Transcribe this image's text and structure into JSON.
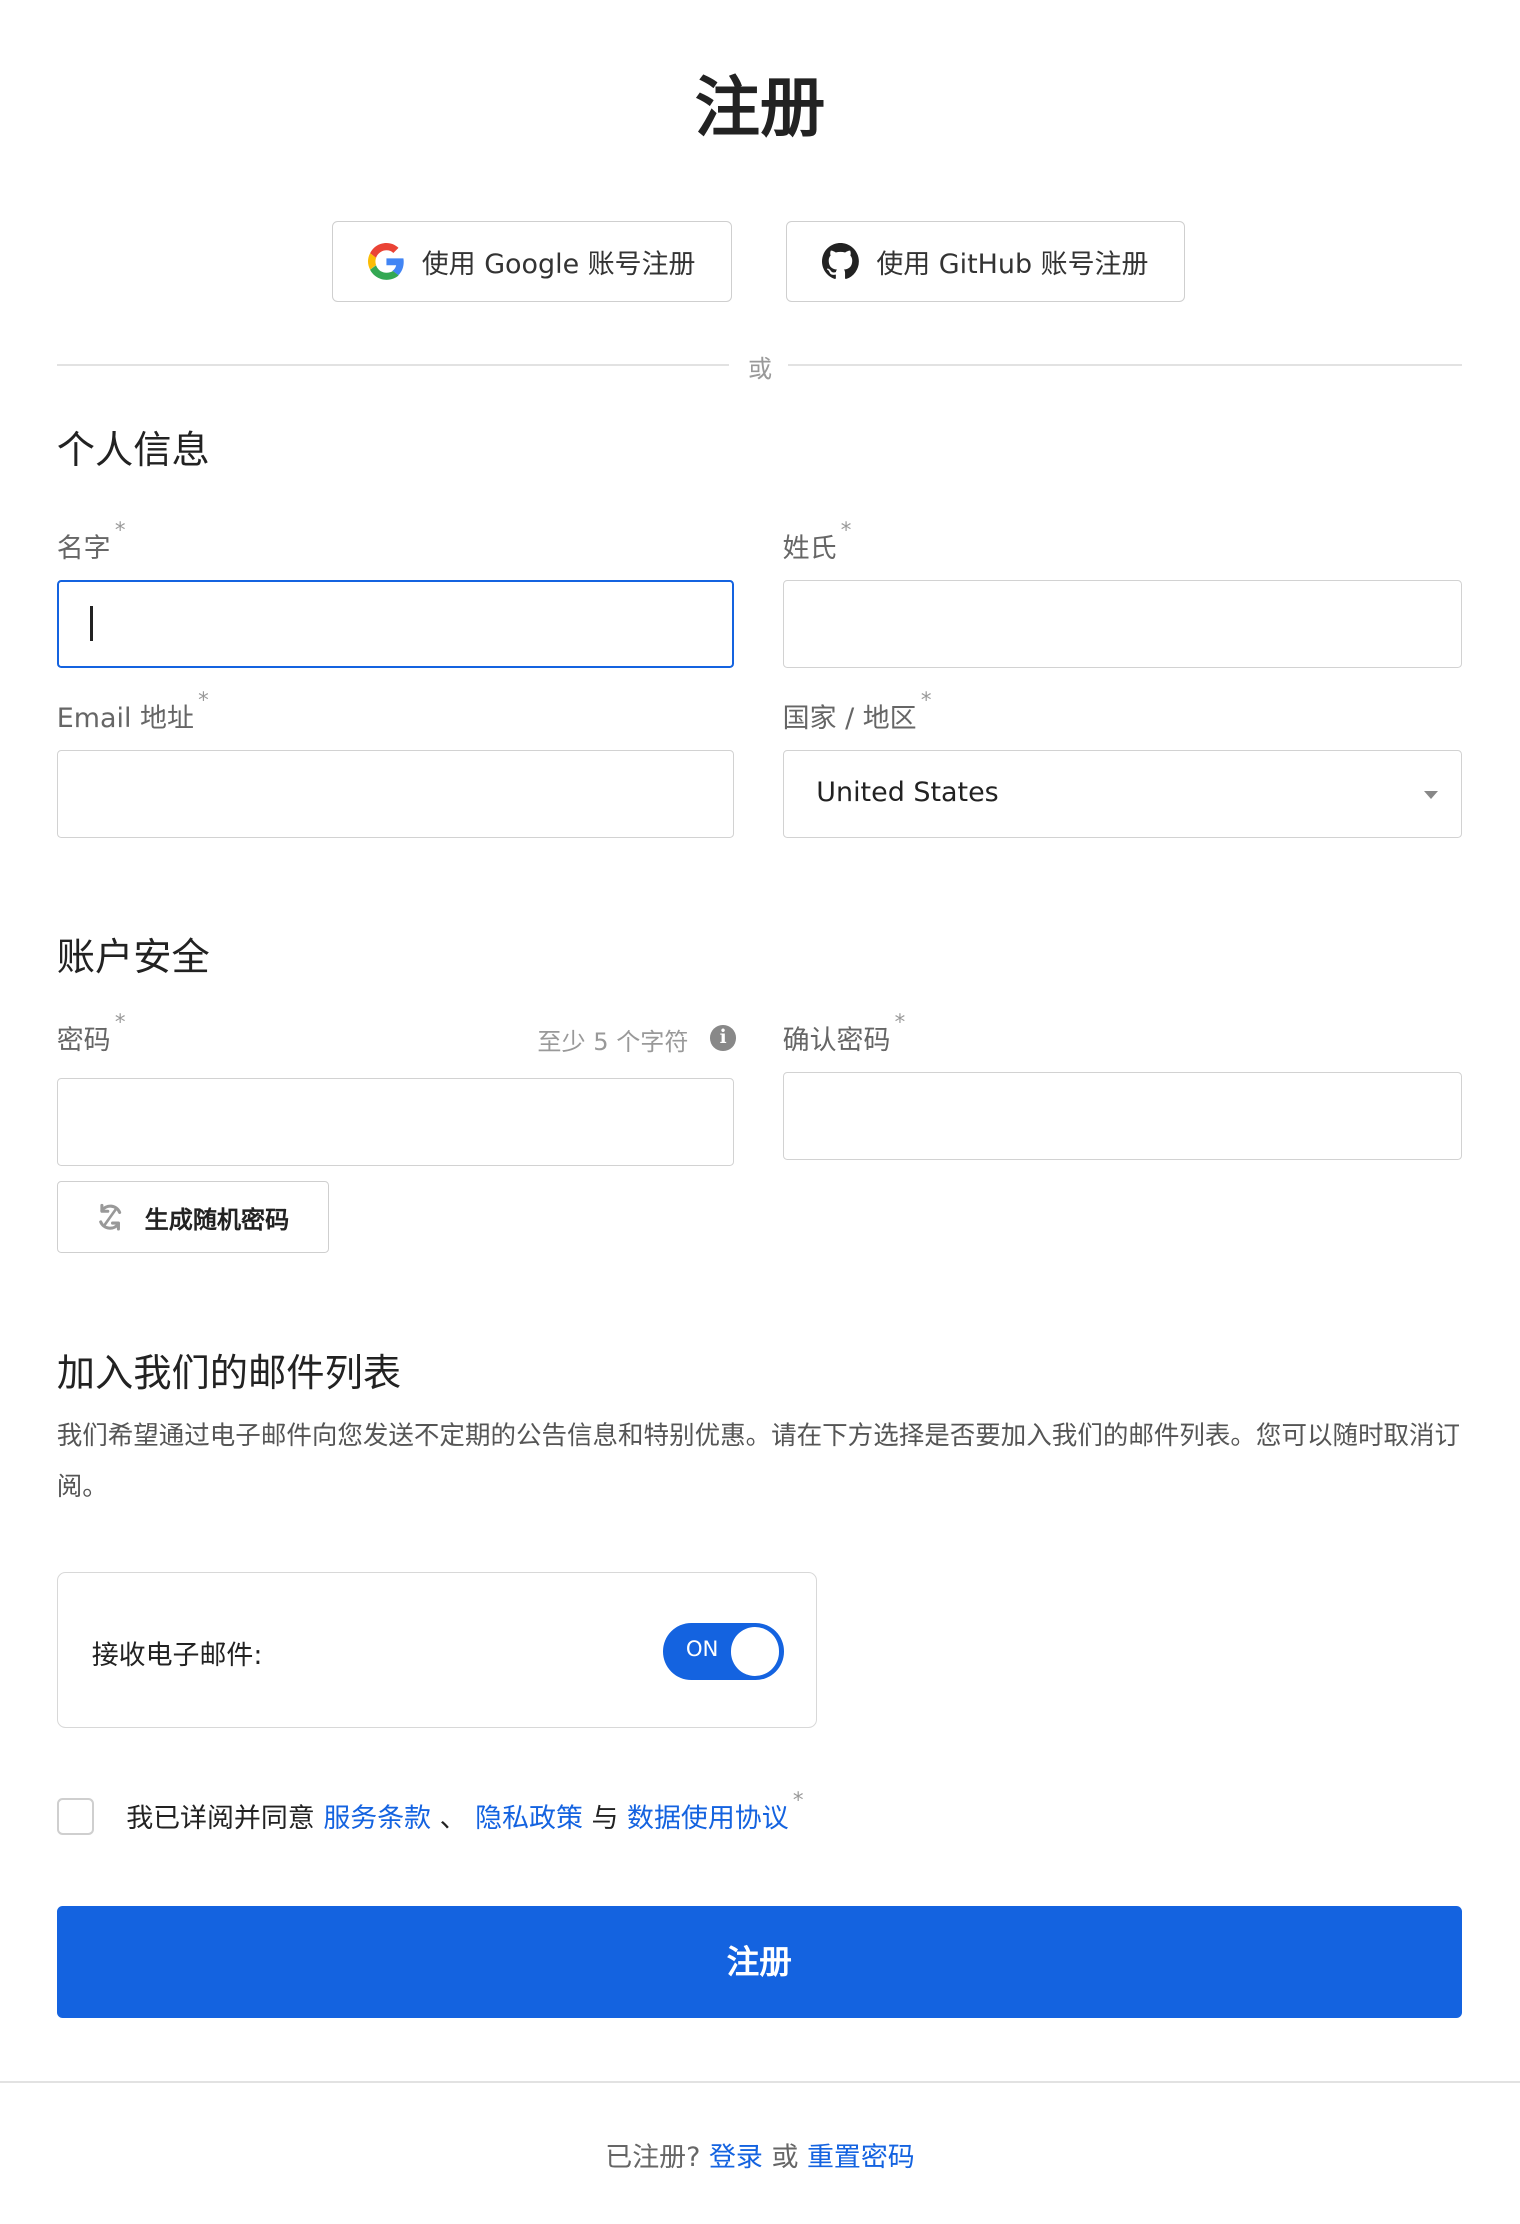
{
  "page": {
    "title": "注册"
  },
  "oauth": {
    "google_label": "使用 Google 账号注册",
    "github_label": "使用 GitHub 账号注册"
  },
  "divider": {
    "text": "或"
  },
  "personal": {
    "title": "个人信息",
    "first_name_label": "名字",
    "last_name_label": "姓氏",
    "email_label": "Email 地址",
    "country_label": "国家 / 地区",
    "country_value": "United States",
    "required_mark": "*"
  },
  "security": {
    "title": "账户安全",
    "password_label": "密码",
    "password_hint": "至少 5 个字符",
    "confirm_label": "确认密码",
    "generate_label": "生成随机密码"
  },
  "mailing": {
    "title": "加入我们的邮件列表",
    "description": "我们希望通过电子邮件向您发送不定期的公告信息和特别优惠。请在下方选择是否要加入我们的邮件列表。您可以随时取消订阅。",
    "receive_label": "接收电子邮件:",
    "toggle_state": "ON"
  },
  "terms": {
    "prefix": "我已详阅并同意",
    "tos": "服务条款",
    "sep1": "、",
    "privacy": "隐私政策",
    "and": "与",
    "data_usage": "数据使用协议"
  },
  "submit": {
    "label": "注册"
  },
  "footer": {
    "already": "已注册?",
    "login": "登录",
    "or": "或",
    "reset": "重置密码"
  },
  "colors": {
    "accent": "#1463e0"
  }
}
